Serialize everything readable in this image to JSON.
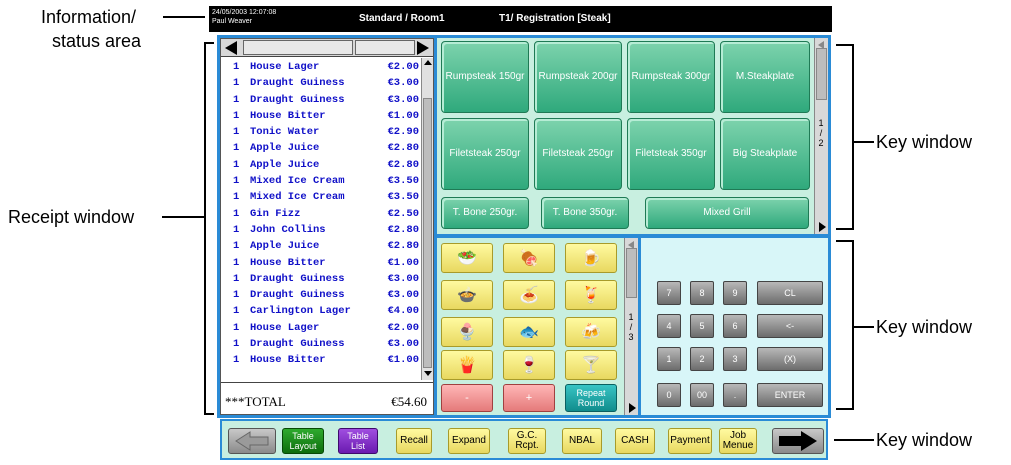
{
  "callouts": {
    "info_line1": "Information/",
    "info_line2": "status area",
    "receipt": "Receipt window",
    "key_top": "Key window",
    "key_mid": "Key window",
    "key_bottom": "Key window"
  },
  "status": {
    "datetime": "24/05/2003 12:07:08",
    "user": "Paul Weaver",
    "location": "Standard / Room1",
    "mode": "T1/ Registration [Steak]"
  },
  "receipt": {
    "lines": [
      {
        "qty": "1",
        "name": "House Lager",
        "price": "€2.00"
      },
      {
        "qty": "1",
        "name": "Draught Guiness",
        "price": "€3.00"
      },
      {
        "qty": "1",
        "name": "Draught Guiness",
        "price": "€3.00"
      },
      {
        "qty": "1",
        "name": "House Bitter",
        "price": "€1.00"
      },
      {
        "qty": "1",
        "name": "Tonic Water",
        "price": "€2.90"
      },
      {
        "qty": "1",
        "name": "Apple Juice",
        "price": "€2.80"
      },
      {
        "qty": "1",
        "name": "Apple Juice",
        "price": "€2.80"
      },
      {
        "qty": "1",
        "name": "Mixed Ice Cream",
        "price": "€3.50"
      },
      {
        "qty": "1",
        "name": "Mixed Ice Cream",
        "price": "€3.50"
      },
      {
        "qty": "1",
        "name": "Gin Fizz",
        "price": "€2.50"
      },
      {
        "qty": "1",
        "name": "John Collins",
        "price": "€2.80"
      },
      {
        "qty": "1",
        "name": "Apple Juice",
        "price": "€2.80"
      },
      {
        "qty": "1",
        "name": "House Bitter",
        "price": "€1.00"
      },
      {
        "qty": "1",
        "name": "Draught Guiness",
        "price": "€3.00"
      },
      {
        "qty": "1",
        "name": "Draught Guiness",
        "price": "€3.00"
      },
      {
        "qty": "1",
        "name": "Carlington Lager",
        "price": "€4.00"
      },
      {
        "qty": "1",
        "name": "House Lager",
        "price": "€2.00"
      },
      {
        "qty": "1",
        "name": "Draught Guiness",
        "price": "€3.00"
      },
      {
        "qty": "1",
        "name": "House Bitter",
        "price": "€1.00"
      }
    ],
    "total_label": "***TOTAL",
    "total_value": "€54.60"
  },
  "top_keys": {
    "k1": "Rumpsteak 150gr",
    "k2": "Rumpsteak 200gr",
    "k3": "Rumpsteak 300gr",
    "k4": "M.Steakplate",
    "k5": "Filetsteak 250gr",
    "k6": "Filetsteak 250gr",
    "k7": "Filetsteak 350gr",
    "k8": "Big Steakplate",
    "k9": "T. Bone 250gr.",
    "k10": "T. Bone 350gr.",
    "k11": "Mixed Grill",
    "page_top": "1",
    "page_sep": "/",
    "page_bottom": "2"
  },
  "bl_keys": {
    "minus": "-",
    "plus": "+",
    "repeat": "Repeat Round",
    "page_top": "1",
    "page_sep": "/",
    "page_bottom": "3",
    "icons": [
      "salad",
      "grilled-meat",
      "beer-mug",
      "soup",
      "plate",
      "cocktail-glass",
      "ice-cream",
      "fish",
      "beer-glass",
      "fries",
      "wine",
      "martini"
    ]
  },
  "keypad": {
    "k7": "7",
    "k8": "8",
    "k9": "9",
    "cl": "CL",
    "k4": "4",
    "k5": "5",
    "k6": "6",
    "back": "<-",
    "k1": "1",
    "k2": "2",
    "k3": "3",
    "times": "(X)",
    "k0": "0",
    "k00": "00",
    "dot": ".",
    "enter": "ENTER"
  },
  "bottom": {
    "table_layout": "Table Layout",
    "table_list": "Table List",
    "recall": "Recall",
    "expand": "Expand",
    "gc_rcpt": "G.C. Rcpt.",
    "nbal": "NBAL",
    "cash": "CASH",
    "payment": "Payment",
    "job_menue": "Job Menue"
  }
}
